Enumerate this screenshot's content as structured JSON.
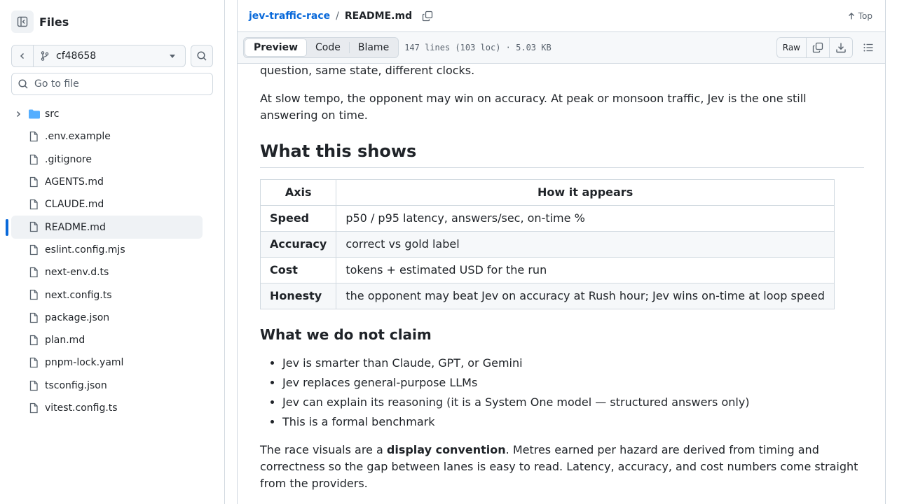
{
  "sidebar": {
    "title": "Files",
    "branch": "cf48658",
    "goto_placeholder": "Go to file",
    "items": [
      {
        "label": "src",
        "type": "folder"
      },
      {
        "label": ".env.example",
        "type": "file"
      },
      {
        "label": ".gitignore",
        "type": "file"
      },
      {
        "label": "AGENTS.md",
        "type": "file"
      },
      {
        "label": "CLAUDE.md",
        "type": "file"
      },
      {
        "label": "README.md",
        "type": "file",
        "active": true
      },
      {
        "label": "eslint.config.mjs",
        "type": "file"
      },
      {
        "label": "next-env.d.ts",
        "type": "file"
      },
      {
        "label": "next.config.ts",
        "type": "file"
      },
      {
        "label": "package.json",
        "type": "file"
      },
      {
        "label": "plan.md",
        "type": "file"
      },
      {
        "label": "pnpm-lock.yaml",
        "type": "file"
      },
      {
        "label": "tsconfig.json",
        "type": "file"
      },
      {
        "label": "vitest.config.ts",
        "type": "file"
      }
    ]
  },
  "header": {
    "repo": "jev-traffic-race",
    "separator": "/",
    "file": "README.md",
    "top_label": "Top"
  },
  "toolbar": {
    "tabs": [
      "Preview",
      "Code",
      "Blame"
    ],
    "meta": "147 lines (103 loc) · 5.03 KB",
    "raw_label": "Raw"
  },
  "readme": {
    "intro_tail": "question, same state, different clocks.",
    "p_tempo": "At slow tempo, the opponent may win on accuracy. At peak or monsoon traffic, Jev is the one still answering on time.",
    "h_shows": "What this shows",
    "table": {
      "headers": [
        "Axis",
        "How it appears"
      ],
      "rows": [
        [
          "Speed",
          "p50 / p95 latency, answers/sec, on-time %"
        ],
        [
          "Accuracy",
          "correct vs gold label"
        ],
        [
          "Cost",
          "tokens + estimated USD for the run"
        ],
        [
          "Honesty",
          "the opponent may beat Jev on accuracy at Rush hour; Jev wins on-time at loop speed"
        ]
      ]
    },
    "h_claims": "What we do not claim",
    "claims": [
      "Jev is smarter than Claude, GPT, or Gemini",
      "Jev replaces general-purpose LLMs",
      "Jev can explain its reasoning (it is a System One model — structured answers only)",
      "This is a formal benchmark"
    ],
    "p_visuals_a": "The race visuals are a ",
    "p_visuals_bold": "display convention",
    "p_visuals_b": ". Metres earned per hazard are derived from timing and correctness so the gap between lanes is easy to read. Latency, accuracy, and cost numbers come straight from the providers."
  },
  "colors": {
    "link": "#0969da",
    "border": "#d1d9e0",
    "folder": "#54aeff",
    "muted": "#59636e"
  }
}
